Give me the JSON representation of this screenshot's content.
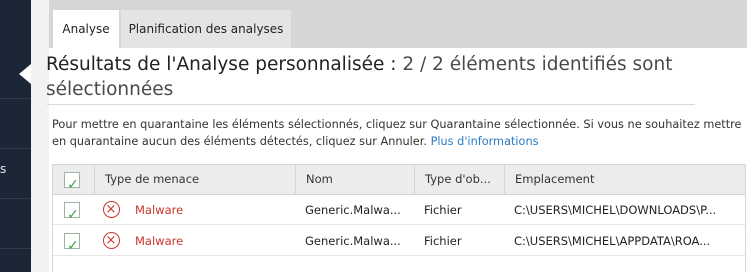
{
  "colors": {
    "rail": "#1b2736",
    "threat_red": "#c9362b",
    "check_green": "#3fa34d",
    "link": "#2a7cc7"
  },
  "left_rail": {
    "glyph": "s"
  },
  "tabs": [
    {
      "label": "Analyse",
      "active": true
    },
    {
      "label": "Planification des analyses",
      "active": false
    }
  ],
  "header": {
    "title_main": "Résultats de l'Analyse personnalisée :",
    "title_suffix": " 2 / 2 éléments identifiés sont sélectionnées"
  },
  "description": {
    "text": "Pour mettre en quarantaine les éléments sélectionnés, cliquez sur Quarantaine sélectionnée. Si vous ne souhaitez mettre en quarantaine aucun des éléments détectés, cliquez sur Annuler. ",
    "link": "Plus d'informations"
  },
  "table": {
    "header_check_icon": "checkmark-icon",
    "columns": [
      "Type de menace",
      "Nom",
      "Type d'ob...",
      "Emplacement"
    ],
    "rows": [
      {
        "checked": true,
        "threat_icon": "threat-x-icon",
        "type": "Malware",
        "nom": "Generic.Malwa...",
        "type_objet": "Fichier",
        "emplacement": "C:\\USERS\\MICHEL\\DOWNLOADS\\P..."
      },
      {
        "checked": true,
        "threat_icon": "threat-x-icon",
        "type": "Malware",
        "nom": "Generic.Malwa...",
        "type_objet": "Fichier",
        "emplacement": "C:\\USERS\\MICHEL\\APPDATA\\ROA..."
      }
    ]
  }
}
